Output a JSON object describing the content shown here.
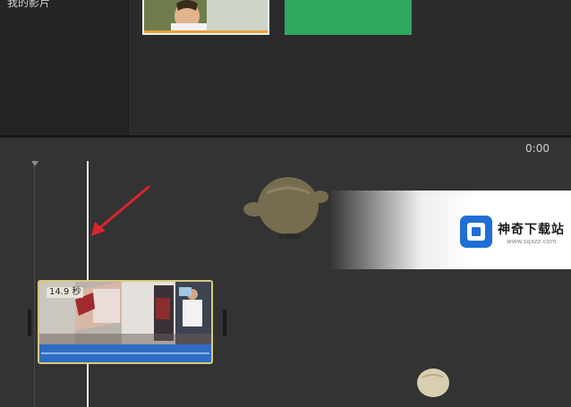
{
  "sidebar": {
    "library_label": "我的影片"
  },
  "timeline": {
    "timecode": "0:00"
  },
  "clip": {
    "duration": "14.9 秒"
  },
  "watermark": {
    "title": "神奇下载站",
    "url": "www.sqxzz.com"
  },
  "colors": {
    "clip_border": "#d8c878",
    "clip_audio": "#2e6cc4",
    "thumb_green": "#2fa860",
    "arrow_red": "#d8262e",
    "watermark_logo": "#1f6fd6"
  }
}
